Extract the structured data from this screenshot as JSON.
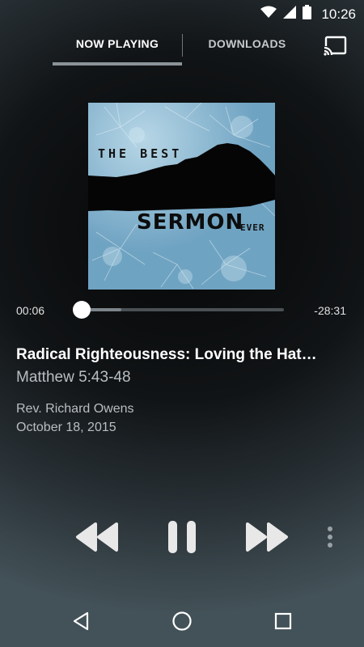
{
  "status_bar": {
    "time": "10:26",
    "icons": [
      "wifi-icon",
      "cellular-signal-icon",
      "battery-icon"
    ]
  },
  "tabs": [
    {
      "label": "NOW PLAYING",
      "active": true
    },
    {
      "label": "DOWNLOADS",
      "active": false
    }
  ],
  "cast_icon": "cast-icon",
  "artwork": {
    "line1": "THE BEST",
    "line2": "SERMON",
    "line3": "EVER"
  },
  "player": {
    "elapsed": "00:06",
    "remaining": "-28:31",
    "progress_fraction": 0.0035,
    "buffered_fraction": 0.2
  },
  "sermon": {
    "title": "Radical Righteousness: Loving the Hat…",
    "scripture": "Matthew 5:43-48",
    "speaker": "Rev. Richard Owens",
    "date": "October 18, 2015"
  },
  "controls": [
    "rewind-icon",
    "pause-icon",
    "fast-forward-icon",
    "more-vertical-icon"
  ],
  "nav_bar": [
    "back-icon",
    "home-icon",
    "recents-icon"
  ],
  "colors": {
    "accent_underline": "#8b9499",
    "control_fill": "#e8e8e8",
    "secondary_text": "#b9bec2"
  }
}
